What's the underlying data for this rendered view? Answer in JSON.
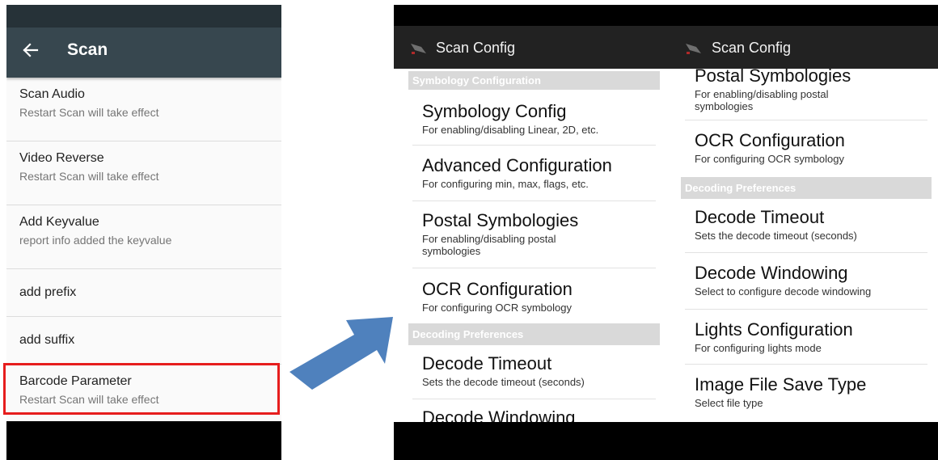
{
  "left_screen": {
    "appbar": {
      "title": "Scan",
      "back_icon": "arrow-left-icon"
    },
    "items": [
      {
        "title": "Scan Audio",
        "subtitle": "Restart Scan will take effect"
      },
      {
        "title": "Video Reverse",
        "subtitle": "Restart Scan will take effect"
      },
      {
        "title": "Add Keyvalue",
        "subtitle": "report info added the keyvalue"
      },
      {
        "title": "add prefix"
      },
      {
        "title": "add suffix"
      },
      {
        "title": "Barcode Parameter",
        "subtitle": "Restart Scan will take effect"
      }
    ],
    "highlight_color": "#e61d1d"
  },
  "arrow": {
    "icon": "right-arrow-icon",
    "color": "#4f81bd"
  },
  "right_screen": {
    "app_title": "Scan Config",
    "column_1": {
      "category_1": "Symbology Configuration",
      "symbology_config": {
        "title": "Symbology Config",
        "subtitle": "For enabling/disabling Linear, 2D, etc."
      },
      "advanced_config": {
        "title": "Advanced Configuration",
        "subtitle": "For configuring min, max, flags, etc."
      },
      "postal": {
        "title": "Postal Symbologies",
        "subtitle": "For enabling/disabling postal symbologies"
      },
      "ocr": {
        "title": "OCR Configuration",
        "subtitle": "For configuring OCR symbology"
      },
      "category_2": "Decoding Preferences",
      "decode_timeout": {
        "title": "Decode Timeout",
        "subtitle": "Sets the decode timeout (seconds)"
      },
      "decode_windowing": {
        "title": "Decode Windowing"
      }
    },
    "column_2": {
      "postal": {
        "title": "Postal Symbologies",
        "subtitle": "For enabling/disabling postal symbologies"
      },
      "ocr": {
        "title": "OCR Configuration",
        "subtitle": "For configuring OCR symbology"
      },
      "category_2": "Decoding Preferences",
      "decode_timeout": {
        "title": "Decode Timeout",
        "subtitle": "Sets the decode timeout (seconds)"
      },
      "decode_windowing": {
        "title": "Decode Windowing",
        "subtitle": "Select to configure decode windowing"
      },
      "lights": {
        "title": "Lights Configuration",
        "subtitle": "For configuring lights mode"
      },
      "image_file": {
        "title": "Image File Save Type",
        "subtitle": "Select file type"
      }
    }
  }
}
